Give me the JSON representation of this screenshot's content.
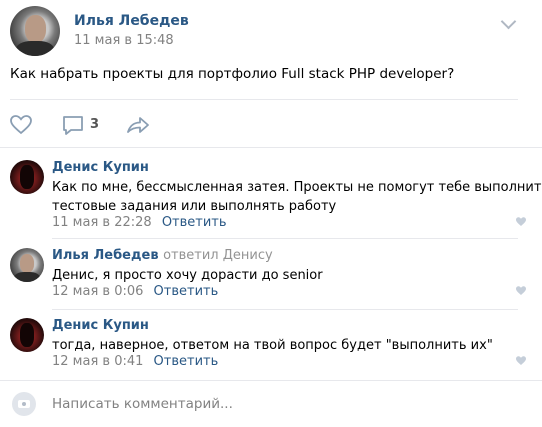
{
  "post": {
    "author": "Илья Лебедев",
    "date": "11 мая в 15:48",
    "text": "Как набрать проекты для портфолио Full stack PHP developer?",
    "comments_count": "3"
  },
  "comments": [
    {
      "author": "Денис Купин",
      "reply_to": "",
      "text_lines": [
        "Как по мне, бессмысленная затея. Проекты не помогут тебе выполнить",
        "тестовые задания или выполнять работу"
      ],
      "date": "11 мая в 22:28",
      "reply_label": "Ответить"
    },
    {
      "author": "Илья Лебедев",
      "reply_to": "ответил Денису",
      "text_lines": [
        "Денис, я просто хочу дорасти до senior"
      ],
      "date": "12 мая в 0:06",
      "reply_label": "Ответить"
    },
    {
      "author": "Денис Купин",
      "reply_to": "",
      "text_lines": [
        "тогда, наверное, ответом на твой вопрос будет \"выполнить их\""
      ],
      "date": "12 мая в 0:41",
      "reply_label": "Ответить"
    }
  ],
  "composer": {
    "placeholder": "Написать комментарий..."
  },
  "icons": {
    "like": "heart-icon",
    "comment": "comment-icon",
    "share": "share-icon",
    "menu": "chevron-down-icon",
    "camera": "camera-icon"
  },
  "colors": {
    "link": "#2a5885",
    "muted": "#828282",
    "divider": "#e7e8ec"
  }
}
